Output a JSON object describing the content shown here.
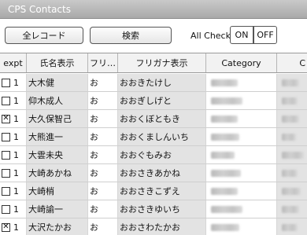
{
  "window": {
    "title": "CPS Contacts"
  },
  "toolbar": {
    "all_records_label": "全レコード",
    "search_label": "検索",
    "all_check_label": "All Check",
    "on_label": "ON",
    "off_label": "OFF"
  },
  "table": {
    "columns": [
      "expt",
      "氏名表示",
      "フリ…",
      "フリガナ表示",
      "Category",
      "C"
    ],
    "rows": [
      {
        "checked": false,
        "value": "1",
        "name": "大木健",
        "furi": "お",
        "kana": "おおきたけし"
      },
      {
        "checked": false,
        "value": "1",
        "name": "仰木成人",
        "furi": "お",
        "kana": "おおぎしげと"
      },
      {
        "checked": true,
        "value": "1",
        "name": "大久保智己",
        "furi": "お",
        "kana": "おおくぼともき"
      },
      {
        "checked": false,
        "value": "1",
        "name": "大熊進一",
        "furi": "お",
        "kana": "おおくましんいち"
      },
      {
        "checked": false,
        "value": "1",
        "name": "大雲未央",
        "furi": "お",
        "kana": "おおぐもみお"
      },
      {
        "checked": false,
        "value": "1",
        "name": "大崎あかね",
        "furi": "お",
        "kana": "おおさきあかね"
      },
      {
        "checked": false,
        "value": "1",
        "name": "大崎梢",
        "furi": "お",
        "kana": "おおさきこずえ"
      },
      {
        "checked": false,
        "value": "1",
        "name": "大崎諭一",
        "furi": "お",
        "kana": "おおさきゆいち"
      },
      {
        "checked": true,
        "value": "1",
        "name": "大沢たかお",
        "furi": "お",
        "kana": "おおさわたかお"
      }
    ]
  }
}
